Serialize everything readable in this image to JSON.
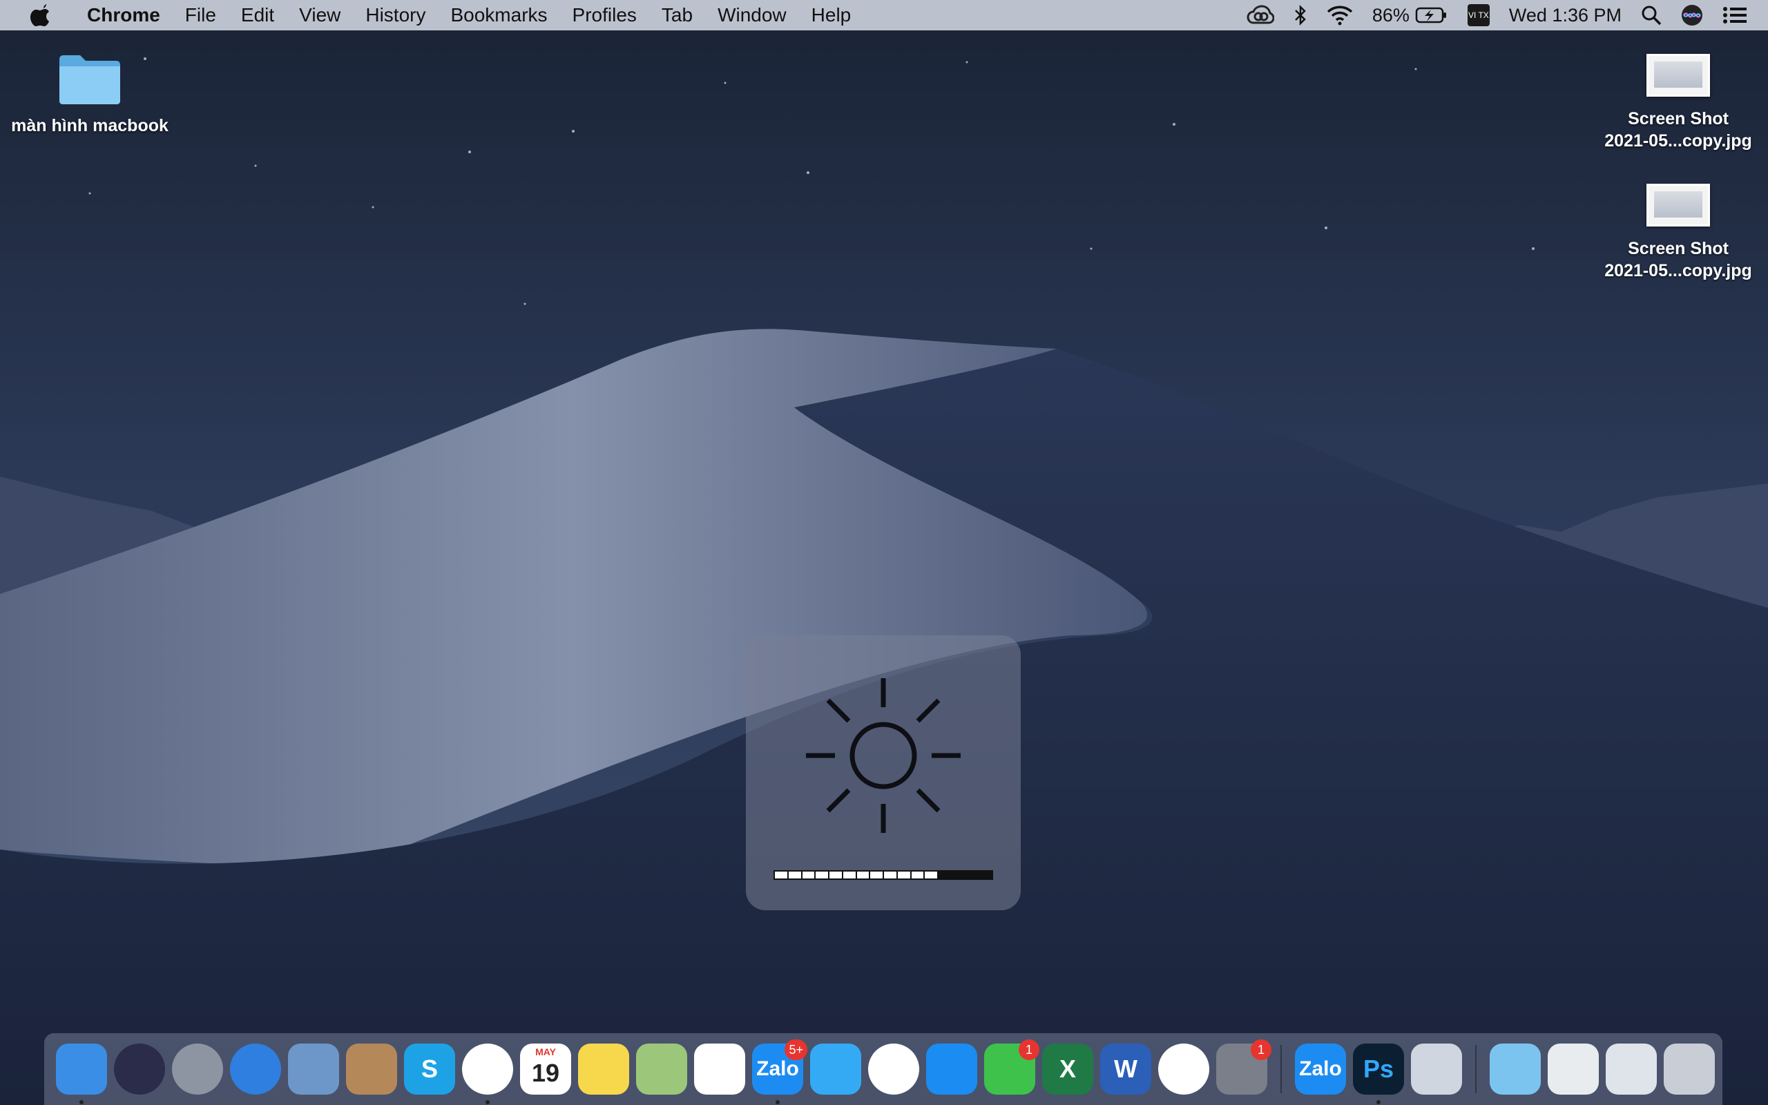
{
  "menubar": {
    "app_name": "Chrome",
    "menus": [
      "File",
      "Edit",
      "View",
      "History",
      "Bookmarks",
      "Profiles",
      "Tab",
      "Window",
      "Help"
    ],
    "battery_percent": "86%",
    "input_method": "VI TX",
    "clock": "Wed 1:36 PM",
    "status_icons": [
      "creative-cloud-icon",
      "bluetooth-icon",
      "wifi-icon",
      "battery-charging-icon",
      "input-method-icon",
      "spotlight-search-icon",
      "siri-icon",
      "notification-center-icon"
    ]
  },
  "desktop": {
    "folder": {
      "label": "màn hình macbook",
      "color": "#7cc4f0"
    },
    "files": [
      {
        "line1": "Screen Shot",
        "line2": "2021-05...copy.jpg"
      },
      {
        "line1": "Screen Shot",
        "line2": "2021-05...copy.jpg"
      }
    ]
  },
  "hud": {
    "icon": "brightness-sun-icon",
    "level_filled": 12,
    "level_total": 16
  },
  "dock": {
    "apps": [
      {
        "name": "finder",
        "label": "",
        "color": "#3a8ee6",
        "running": true
      },
      {
        "name": "siri",
        "label": "",
        "color": "#2b2b4a",
        "running": false
      },
      {
        "name": "launchpad",
        "label": "",
        "color": "#8d95a3",
        "running": false
      },
      {
        "name": "safari",
        "label": "",
        "color": "#2f7fe0",
        "running": false
      },
      {
        "name": "mail-stamp",
        "label": "",
        "color": "#6d97c9",
        "running": false
      },
      {
        "name": "contacts",
        "label": "",
        "color": "#b5885a",
        "running": false
      },
      {
        "name": "skype",
        "label": "S",
        "color": "#1ea2e6",
        "running": false
      },
      {
        "name": "chrome",
        "label": "",
        "color": "#ffffff",
        "running": true
      },
      {
        "name": "calendar",
        "label": "19",
        "color": "#ffffff",
        "running": false,
        "month": "MAY"
      },
      {
        "name": "notes",
        "label": "",
        "color": "#f7d74c",
        "running": false
      },
      {
        "name": "maps",
        "label": "",
        "color": "#9cc77b",
        "running": false
      },
      {
        "name": "reminders",
        "label": "",
        "color": "#ffffff",
        "running": false
      },
      {
        "name": "zalo",
        "label": "Zalo",
        "color": "#1d8cf2",
        "running": true,
        "badge": "5+"
      },
      {
        "name": "messages",
        "label": "",
        "color": "#34aaf5",
        "running": false
      },
      {
        "name": "photos",
        "label": "",
        "color": "#ffffff",
        "running": false
      },
      {
        "name": "app-store",
        "label": "",
        "color": "#1b8cf2",
        "running": false
      },
      {
        "name": "facetime",
        "label": "",
        "color": "#3ec24c",
        "running": false,
        "badge": "1"
      },
      {
        "name": "excel",
        "label": "X",
        "color": "#1f7a45",
        "running": false
      },
      {
        "name": "word",
        "label": "W",
        "color": "#2b5fb8",
        "running": false
      },
      {
        "name": "itunes",
        "label": "",
        "color": "#ffffff",
        "running": false
      },
      {
        "name": "system-preferences",
        "label": "",
        "color": "#7a7f89",
        "running": false,
        "badge": "1"
      }
    ],
    "apps_right": [
      {
        "name": "zalo-2",
        "label": "Zalo",
        "color": "#1d8cf2",
        "running": false
      },
      {
        "name": "photoshop",
        "label": "Ps",
        "color": "#0b1f32",
        "running": true
      },
      {
        "name": "preview",
        "label": "",
        "color": "#cfd6e0",
        "running": false
      }
    ],
    "stacks": [
      {
        "name": "downloads-folder",
        "label": "",
        "color": "#7cc4f0"
      },
      {
        "name": "documents-stack",
        "label": "",
        "color": "#e9ecef"
      },
      {
        "name": "screenshot-stack",
        "label": "",
        "color": "#dfe3ea"
      },
      {
        "name": "trash",
        "label": "",
        "color": "#c9ced6"
      }
    ]
  }
}
